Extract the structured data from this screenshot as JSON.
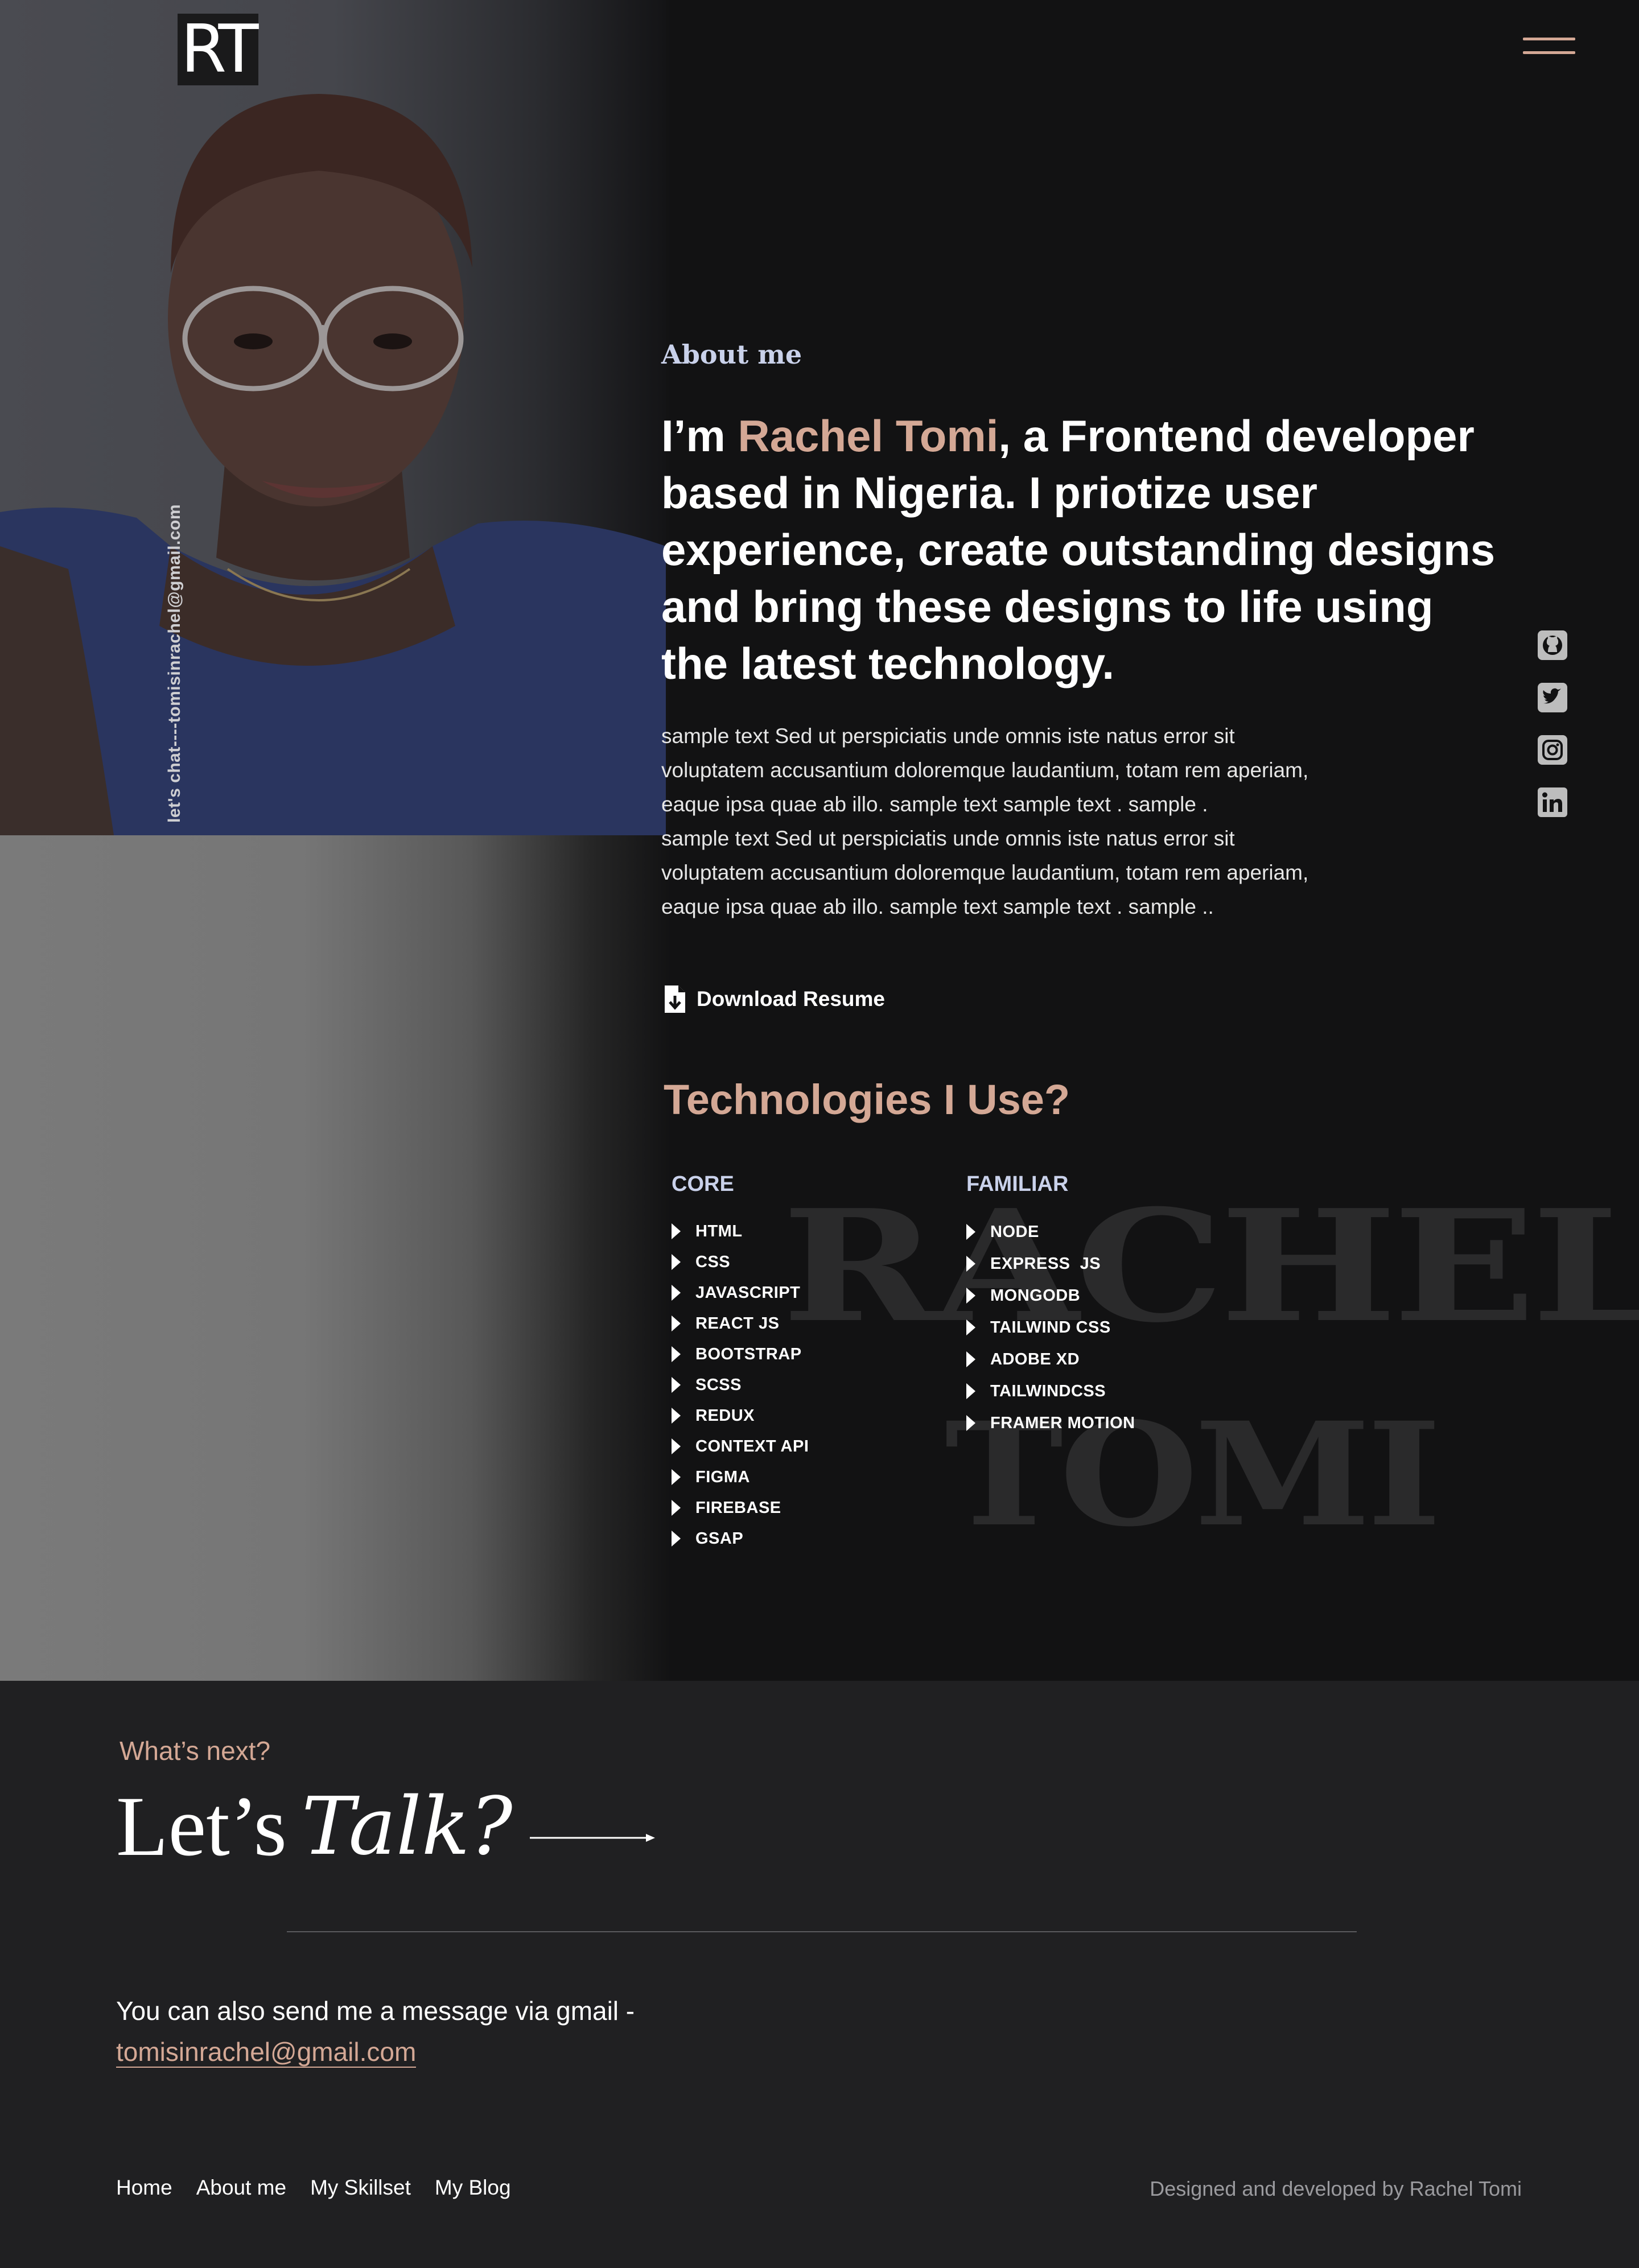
{
  "header": {
    "logo_text": "RT",
    "menu_icon": "hamburger-icon"
  },
  "side_email": "let's chat----tomisinrachel@gmail.com",
  "about": {
    "label": "About me",
    "intro_prefix": "I’m ",
    "intro_name": "Rachel Tomi",
    "intro_suffix": ", a Frontend developer based in Nigeria. I priotize user experience, create outstanding designs and bring these designs to life using the latest technology.",
    "bio_lines": [
      "sample text  Sed ut perspiciatis unde omnis iste natus error sit",
      "voluptatem accusantium doloremque laudantium, totam rem aperiam,",
      "eaque ipsa quae ab illo. sample text sample text . sample .",
      "sample text  Sed ut perspiciatis unde omnis iste natus error sit",
      "voluptatem accusantium doloremque laudantium, totam rem aperiam,",
      "eaque ipsa quae ab illo. sample text sample text . sample .."
    ],
    "resume_label": "Download Resume",
    "resume_icon": "file-download-icon"
  },
  "socials": [
    {
      "name": "github-icon"
    },
    {
      "name": "twitter-icon"
    },
    {
      "name": "instagram-icon"
    },
    {
      "name": "linkedin-icon"
    }
  ],
  "tech": {
    "title": "Technologies I Use?",
    "watermark_line1": "RACHEL",
    "watermark_line2": "TOMI",
    "core_heading": "CORE",
    "core": [
      "HTML",
      "CSS",
      "JAVASCRIPT",
      "REACT JS",
      "BOOTSTRAP",
      "SCSS",
      "REDUX",
      "CONTEXT API",
      "FIGMA",
      "FIREBASE",
      "GSAP"
    ],
    "familiar_heading": "FAMILIAR",
    "familiar": [
      "NODE",
      "EXPRESS  JS",
      "MONGODB",
      "TAILWIND CSS",
      "ADOBE XD",
      "TAILWINDCSS",
      "FRAMER MOTION"
    ]
  },
  "contact": {
    "whats_next": "What’s next?",
    "lets": "Let’s",
    "talk": "Talk?",
    "message_prefix": "You can also send me a message via gmail -",
    "email": "tomisinrachel@gmail.com"
  },
  "footer": {
    "nav": [
      "Home",
      "About me",
      "My Skillset",
      "My Blog"
    ],
    "credit": "Designed and developed by Rachel Tomi"
  },
  "colors": {
    "accent": "#d4a895",
    "label_blue": "#c9d1ea",
    "background": "#121213",
    "footer_bg": "#202022"
  }
}
